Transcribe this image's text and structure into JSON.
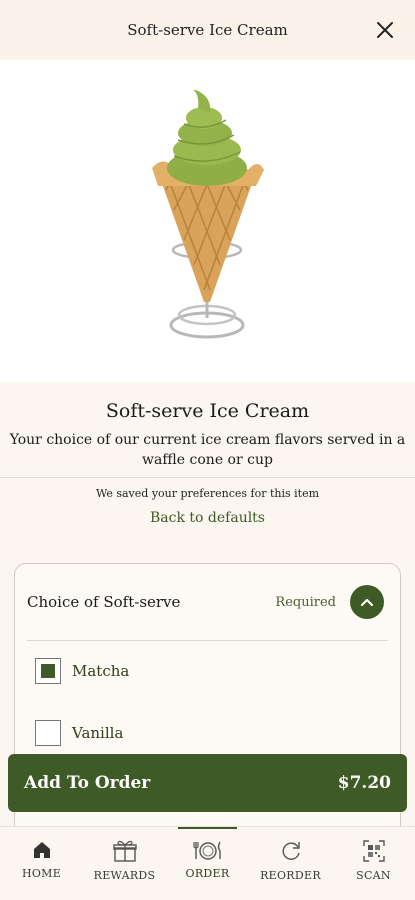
{
  "header": {
    "title": "Soft-serve Ice Cream",
    "close_icon": "close-icon"
  },
  "item": {
    "title": "Soft-serve Ice Cream",
    "description": "Your choice of our current ice cream flavors served in a waffle cone or cup",
    "saved_note": "We saved your preferences for this item",
    "reset_link": "Back to defaults"
  },
  "options": {
    "title": "Choice of Soft-serve",
    "required_label": "Required",
    "collapse_icon": "chevron-up-icon",
    "items": [
      {
        "label": "Matcha",
        "checked": true
      },
      {
        "label": "Vanilla",
        "checked": false
      }
    ]
  },
  "cta": {
    "label": "Add To Order",
    "price": "$7.20"
  },
  "tabs": [
    {
      "label": "HOME",
      "icon": "home-icon",
      "active": false
    },
    {
      "label": "REWARDS",
      "icon": "gift-icon",
      "active": false
    },
    {
      "label": "ORDER",
      "icon": "dining-icon",
      "active": true
    },
    {
      "label": "REORDER",
      "icon": "reorder-icon",
      "active": false
    },
    {
      "label": "SCAN",
      "icon": "qr-scan-icon",
      "active": false
    }
  ],
  "colors": {
    "accent": "#3e5a26",
    "background": "#fbf6f0",
    "matcha": "#93b24a",
    "cone": "#d9a35a"
  }
}
